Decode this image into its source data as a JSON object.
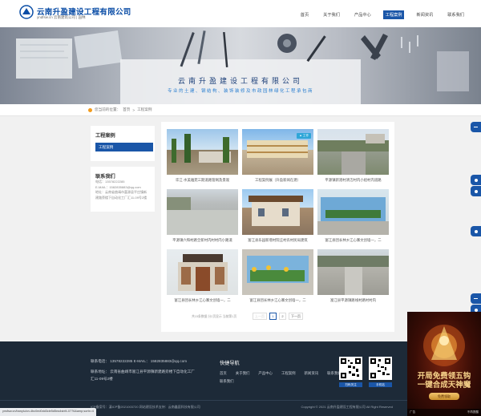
{
  "header": {
    "logo_title": "云南升盈建设工程有限公司",
    "logo_sub": "yndfsw.cn  云南建筑公司 | 园林",
    "nav": [
      {
        "label": "首页",
        "active": false
      },
      {
        "label": "关于我们",
        "active": false
      },
      {
        "label": "产品中心",
        "active": false
      },
      {
        "label": "工程案例",
        "active": true
      },
      {
        "label": "新闻资讯",
        "active": false
      },
      {
        "label": "联系我们",
        "active": false
      }
    ]
  },
  "banner": {
    "title": "云南升盈建设工程有限公司",
    "subtitle": "专业的土建、钢结构、装饰装修及市政园林绿化工程承包商"
  },
  "breadcrumb": {
    "prefix": "您当前的位置：",
    "home": "首页",
    "sep": ">",
    "current": "工程案例"
  },
  "sidebar": {
    "category_title": "工程案例",
    "category_item": "工程案例",
    "contact_title": "联系我们",
    "contact_lines": [
      "电话：13578222285",
      "E-MAIL：1582835883@qq.com",
      "地址：云南省曲靖市富源县平庄镇新",
      "建路旁楼下自动化工厂汇11-09号2楼"
    ]
  },
  "products": [
    {
      "caption": "华江·水美雅苑三期道路管网及景观",
      "hot": false
    },
    {
      "caption": "工程案例展（升盈新闻在建）",
      "hot": true,
      "hot_label": "▲ 工作"
    },
    {
      "caption": "平源镇新港村清洁村内小组村内道路",
      "hot": false
    },
    {
      "caption": "平源镇六和村路全新村内村村内小路道",
      "hot": false
    },
    {
      "caption": "富江县乐园新增村院庄村农村民局建筑",
      "hot": false
    },
    {
      "caption": "富江县团长林乡江心寨文创墙一，二",
      "hot": false
    },
    {
      "caption": "富江县团长林乡江心寨文创墙一，二",
      "hot": false
    },
    {
      "caption": "富江县团长林乡江心寨文创墙一，二",
      "hot": false
    },
    {
      "caption": "富江县平源镇路线村路村村内",
      "hot": false
    }
  ],
  "pager": {
    "info": "共15条数据 分2页显示 当前第1页",
    "prev": "上一页",
    "pages": [
      "1",
      "2"
    ],
    "next": "下一页"
  },
  "footer": {
    "phone_line": "联系电话：  13578222285      E-MAIL：  1582835883@qq.com",
    "address_line": "联系地址：  云南省曲靖市富江县平源镇新建路旁楼下自动化工厂",
    "address_line2": "汇11-09号2楼",
    "quick_title": "快捷导航",
    "quick_links": [
      "首页",
      "关于我们",
      "产品中心",
      "工程案例",
      "新闻资讯",
      "联系我们"
    ],
    "quick_links2": "联系我们",
    "qr1_caption": "扫码关注",
    "qr2_caption": "手机站",
    "icp": "ICP备案号：滇ICP备2021003720     网站建设技术支持：云南鑫庭科技有限公司",
    "copyright": "Copyright © 2021 云南升盈建设工程有限公司 All Right Reserved"
  },
  "status_url": "ynsfsw.cn/banyiu/cn-4bc0ed0dd3cle5d5ea4sbf4-0776&amp;sortx=4",
  "ad": {
    "headline1": "开局免费领五钩",
    "headline2": "一键合成天神魔",
    "button": "免费领取",
    "tag": "广告",
    "close": "不再提醒"
  }
}
